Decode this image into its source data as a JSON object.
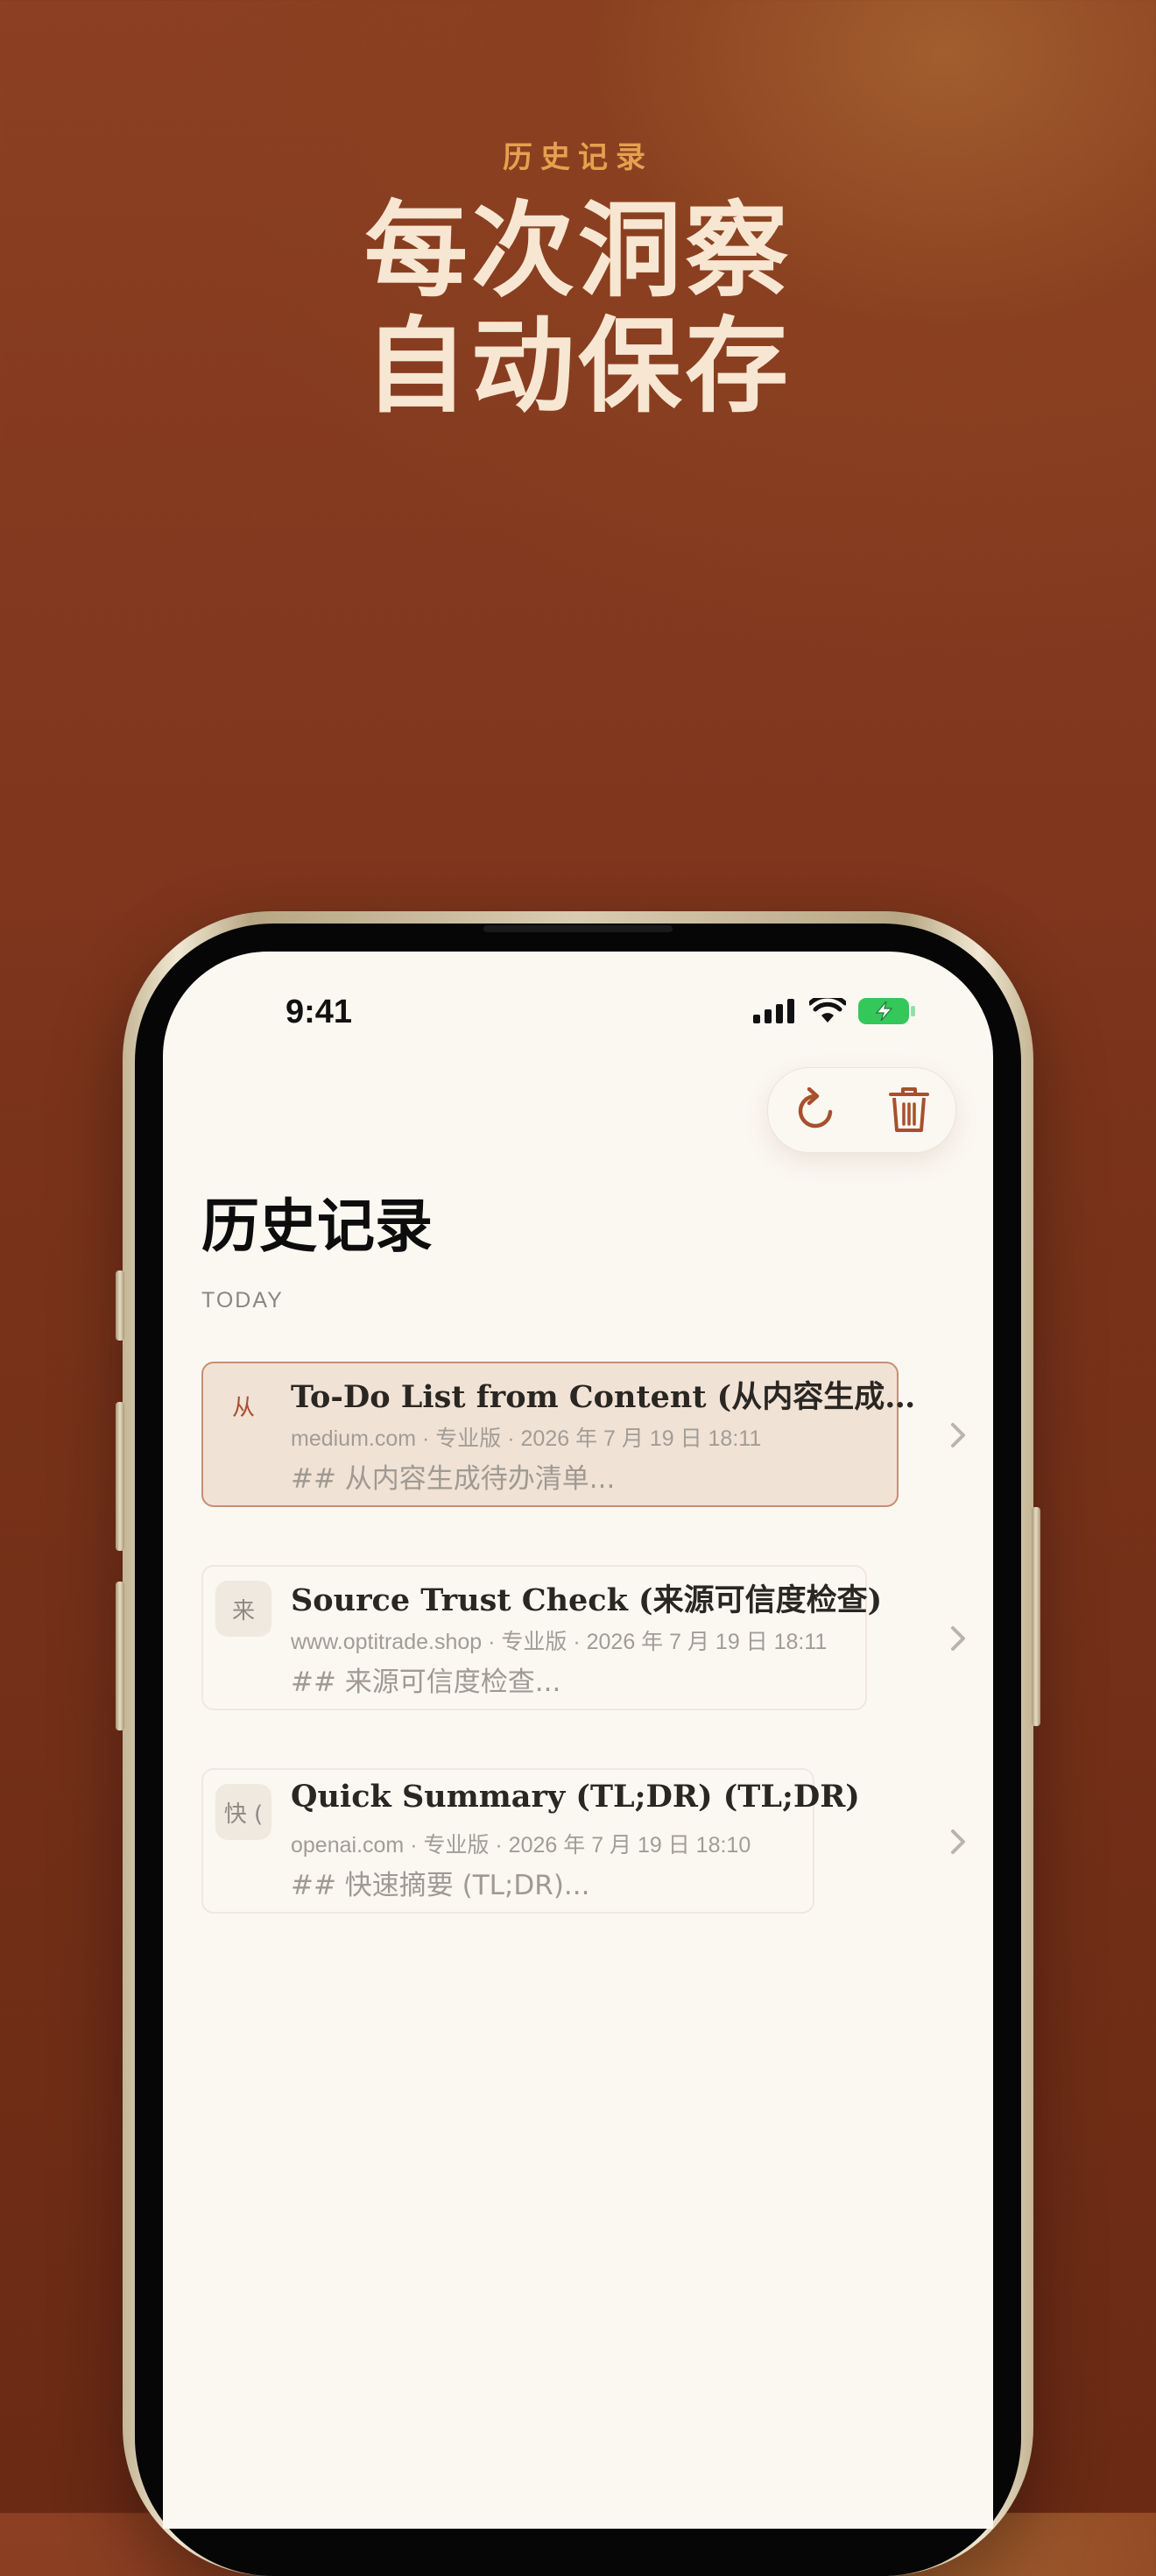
{
  "hero": {
    "eyebrow": "历史记录",
    "title_line1": "每次洞察",
    "title_line2": "自动保存"
  },
  "status_bar": {
    "time": "9:41"
  },
  "toolbar": {
    "refresh_icon": "refresh-icon",
    "delete_icon": "trash-icon"
  },
  "page": {
    "title": "历史记录",
    "section_label": "TODAY"
  },
  "history": [
    {
      "badge": "从",
      "title": "To-Do List from Content (从内容生成…",
      "meta": "medium.com · 专业版 · 2026 年 7 月 19 日 18:11",
      "preview": "## 从内容生成待办清单...",
      "selected": true
    },
    {
      "badge": "来",
      "title": "Source Trust Check (来源可信度检查)",
      "meta": "www.optitrade.shop · 专业版 · 2026 年 7 月 19 日 18:11",
      "preview": "## 来源可信度检查...",
      "selected": false
    },
    {
      "badge": "快 (",
      "title": "Quick Summary (TL;DR) (TL;DR)",
      "meta": "openai.com · 专业版 · 2026 年 7 月 19 日 18:10",
      "preview": "## 快速摘要 (TL;DR)...",
      "selected": false
    }
  ],
  "colors": {
    "accent": "#a8502e",
    "eyebrow": "#e7a04f",
    "hero_text": "#f7e6d2",
    "battery": "#34c759"
  }
}
